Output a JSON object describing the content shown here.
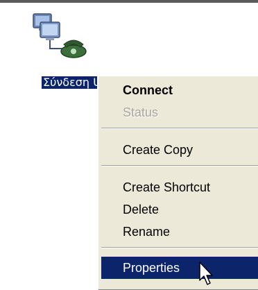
{
  "desktop_icon": {
    "label": "Σύνδεση UoA",
    "icon": "network-connection-icon"
  },
  "context_menu": {
    "items": [
      {
        "label": "Connect",
        "bold": true,
        "enabled": true,
        "selected": false
      },
      {
        "label": "Status",
        "enabled": false,
        "selected": false
      },
      {
        "label": "Create Copy",
        "enabled": true,
        "selected": false
      },
      {
        "label": "Create Shortcut",
        "enabled": true,
        "selected": false
      },
      {
        "label": "Delete",
        "enabled": true,
        "selected": false
      },
      {
        "label": "Rename",
        "enabled": true,
        "selected": false
      },
      {
        "label": "Properties",
        "enabled": true,
        "selected": true
      }
    ]
  },
  "colors": {
    "selection": "#0b246a",
    "menu_bg": "#ece9d8",
    "disabled_text": "#a9a7a0"
  },
  "cursor": "arrow-pointer-icon"
}
